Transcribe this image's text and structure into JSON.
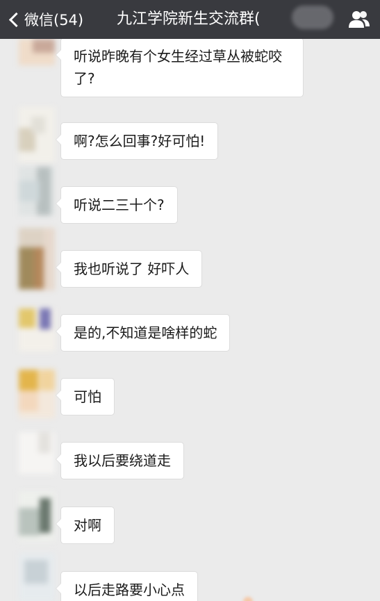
{
  "nav": {
    "back_label": "微信(54)",
    "title": "九江学院新生交流群(",
    "back_icon": "chevron-left-icon",
    "members_icon": "people-icon",
    "bar_color": "#393a3f"
  },
  "chat": {
    "background": "#ebebeb",
    "messages": [
      {
        "text": "听说昨晚有个女生经过草丛被蛇咬了?"
      },
      {
        "text": "啊?怎么回事?好可怕!"
      },
      {
        "text": "听说二三十个?"
      },
      {
        "text": "我也听说了 好吓人"
      },
      {
        "text": "是的,不知道是啥样的蛇"
      },
      {
        "text": "可怕"
      },
      {
        "text": "我以后要绕道走"
      },
      {
        "text": "对啊"
      },
      {
        "text": "以后走路要小心点"
      }
    ]
  }
}
